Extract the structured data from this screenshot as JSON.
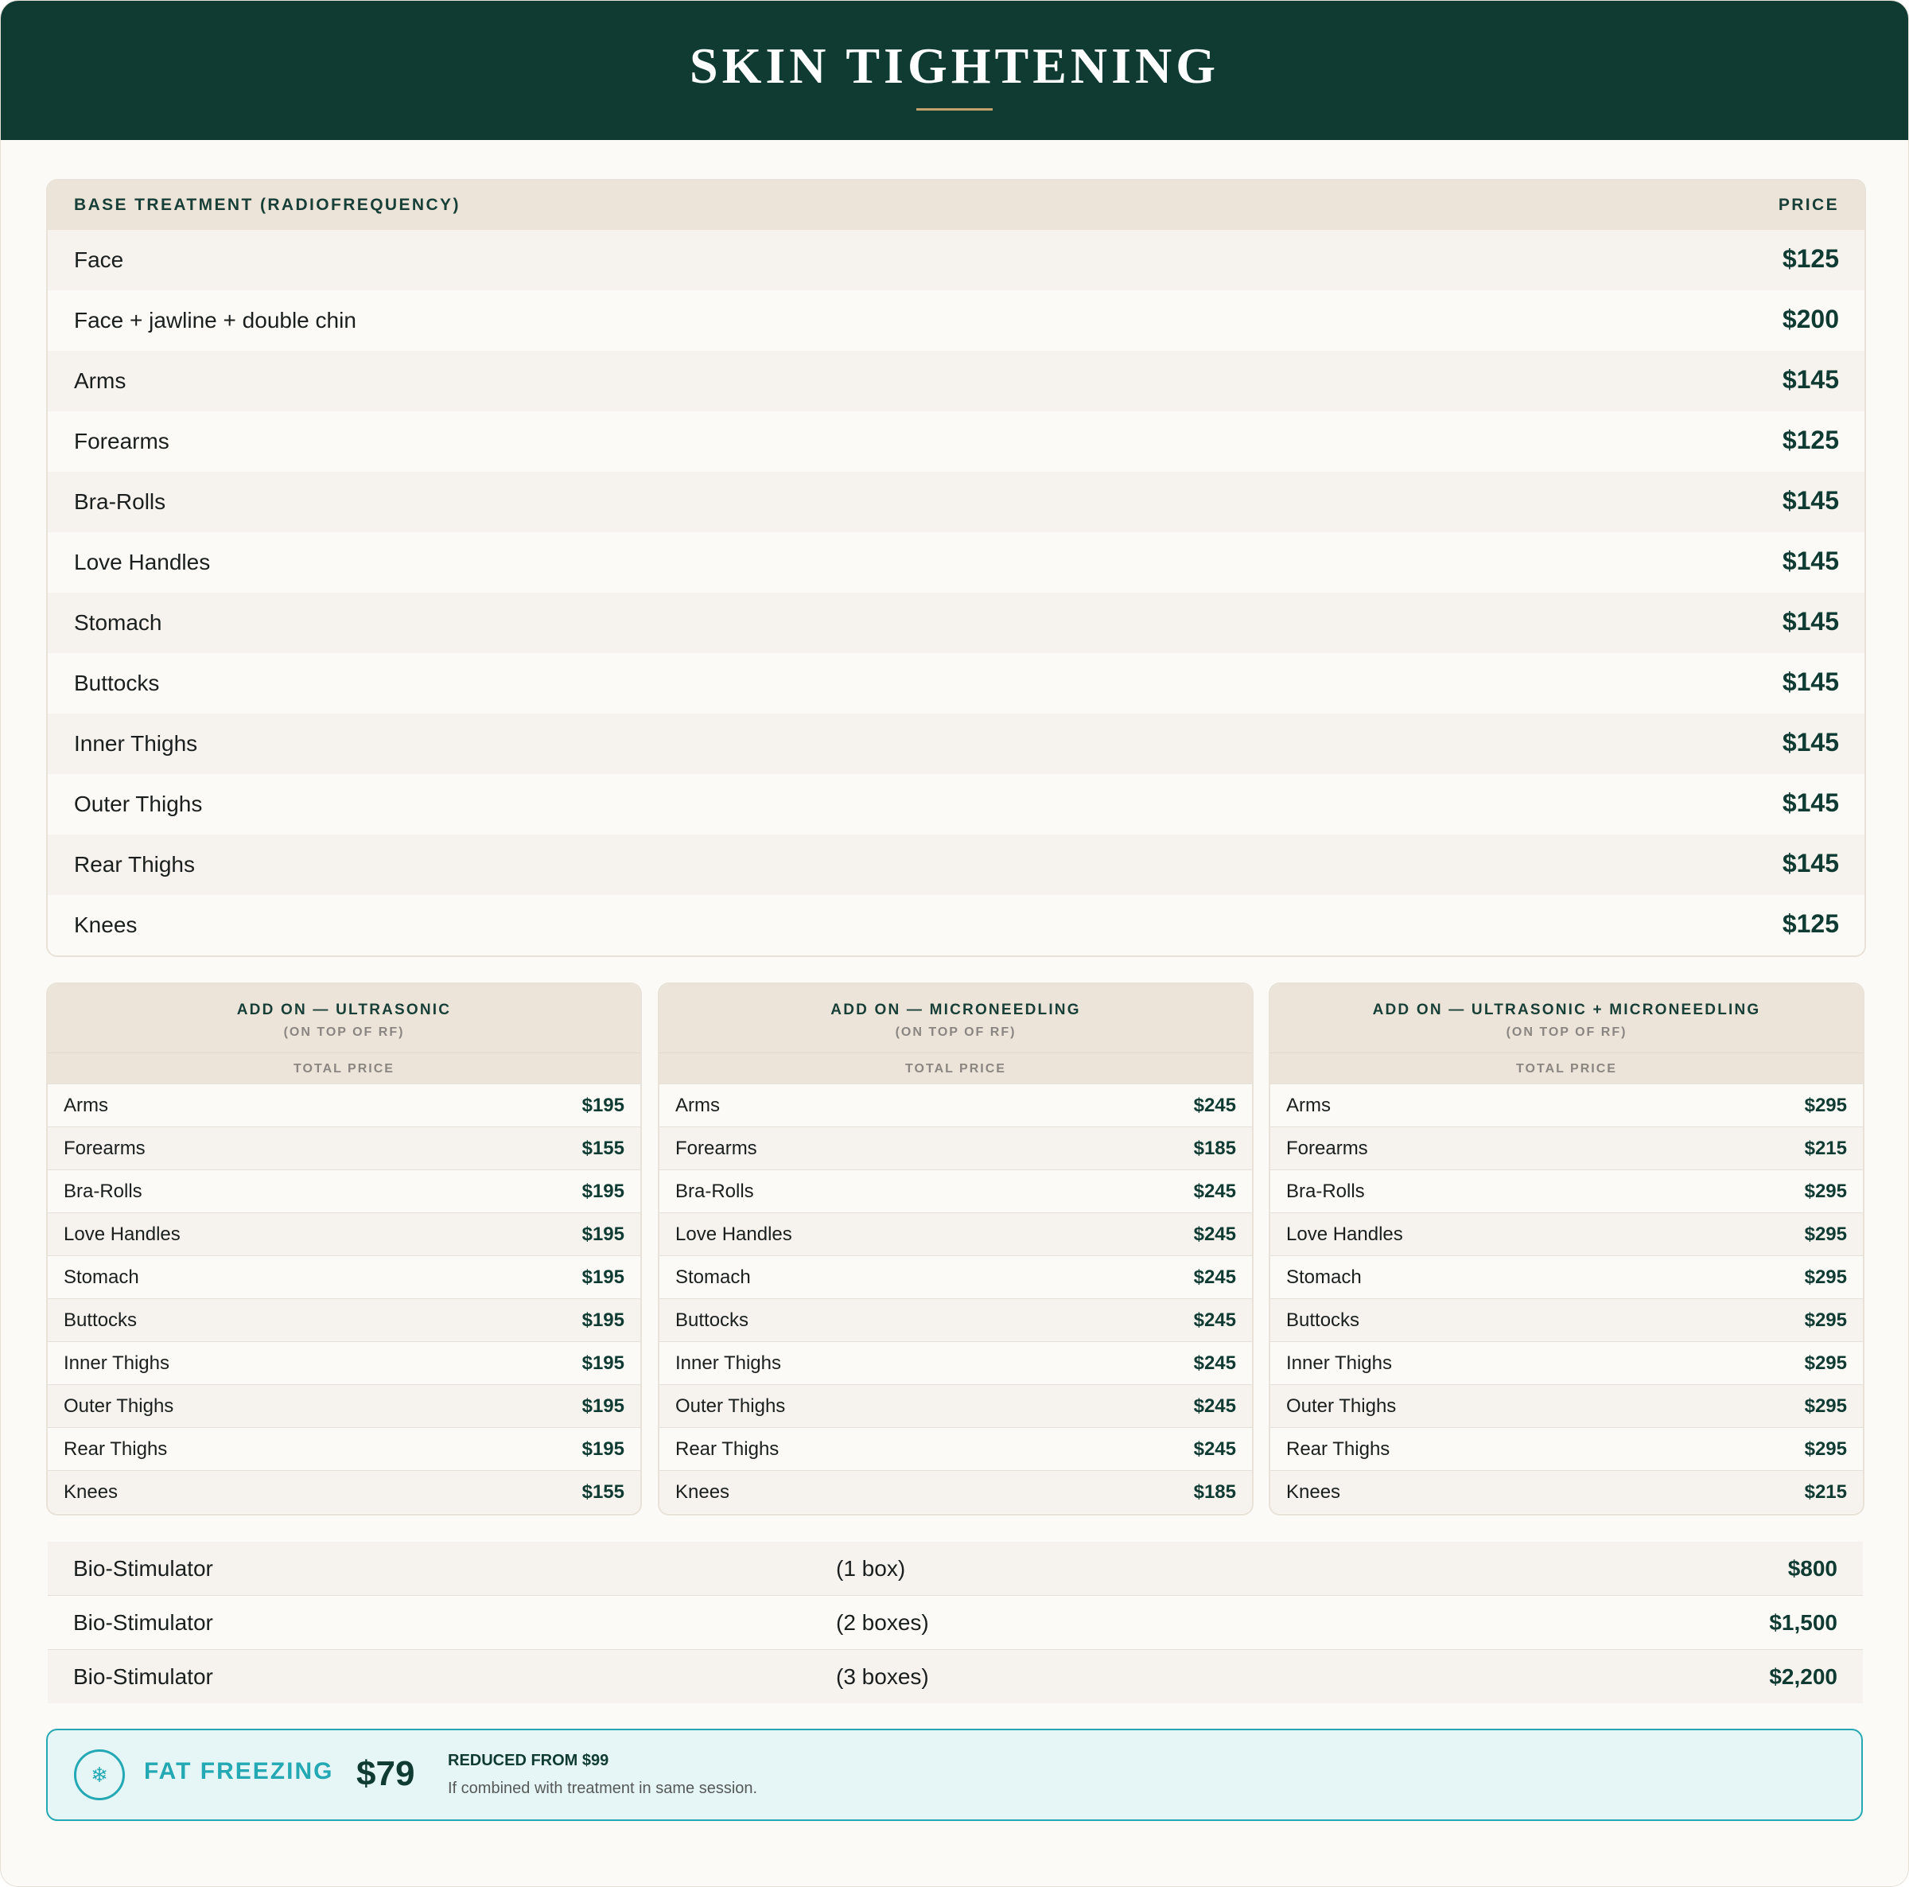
{
  "header": {
    "title": "SKIN TIGHTENING"
  },
  "base_table": {
    "col_treatment": "BASE TREATMENT (RADIOFREQUENCY)",
    "col_price": "PRICE",
    "rows": [
      {
        "name": "Face",
        "price": "$125"
      },
      {
        "name": "Face + jawline + double chin",
        "price": "$200"
      },
      {
        "name": "Arms",
        "price": "$145"
      },
      {
        "name": "Forearms",
        "price": "$125"
      },
      {
        "name": "Bra-Rolls",
        "price": "$145"
      },
      {
        "name": "Love Handles",
        "price": "$145"
      },
      {
        "name": "Stomach",
        "price": "$145"
      },
      {
        "name": "Buttocks",
        "price": "$145"
      },
      {
        "name": "Inner Thighs",
        "price": "$145"
      },
      {
        "name": "Outer Thighs",
        "price": "$145"
      },
      {
        "name": "Rear Thighs",
        "price": "$145"
      },
      {
        "name": "Knees",
        "price": "$125"
      }
    ]
  },
  "addons": [
    {
      "title": "ADD ON — ULTRASONIC",
      "subtitle": "(ON TOP OF RF)",
      "col_label": "TOTAL PRICE",
      "rows": [
        {
          "name": "Arms",
          "price": "$195"
        },
        {
          "name": "Forearms",
          "price": "$155"
        },
        {
          "name": "Bra-Rolls",
          "price": "$195"
        },
        {
          "name": "Love Handles",
          "price": "$195"
        },
        {
          "name": "Stomach",
          "price": "$195"
        },
        {
          "name": "Buttocks",
          "price": "$195"
        },
        {
          "name": "Inner Thighs",
          "price": "$195"
        },
        {
          "name": "Outer Thighs",
          "price": "$195"
        },
        {
          "name": "Rear Thighs",
          "price": "$195"
        },
        {
          "name": "Knees",
          "price": "$155"
        }
      ]
    },
    {
      "title": "ADD ON — MICRONEEDLING",
      "subtitle": "(ON TOP OF RF)",
      "col_label": "TOTAL PRICE",
      "rows": [
        {
          "name": "Arms",
          "price": "$245"
        },
        {
          "name": "Forearms",
          "price": "$185"
        },
        {
          "name": "Bra-Rolls",
          "price": "$245"
        },
        {
          "name": "Love Handles",
          "price": "$245"
        },
        {
          "name": "Stomach",
          "price": "$245"
        },
        {
          "name": "Buttocks",
          "price": "$245"
        },
        {
          "name": "Inner Thighs",
          "price": "$245"
        },
        {
          "name": "Outer Thighs",
          "price": "$245"
        },
        {
          "name": "Rear Thighs",
          "price": "$245"
        },
        {
          "name": "Knees",
          "price": "$185"
        }
      ]
    },
    {
      "title": "ADD ON — ULTRASONIC + MICRONEEDLING",
      "subtitle": "(ON TOP OF RF)",
      "col_label": "TOTAL PRICE",
      "rows": [
        {
          "name": "Arms",
          "price": "$295"
        },
        {
          "name": "Forearms",
          "price": "$215"
        },
        {
          "name": "Bra-Rolls",
          "price": "$295"
        },
        {
          "name": "Love Handles",
          "price": "$295"
        },
        {
          "name": "Stomach",
          "price": "$295"
        },
        {
          "name": "Buttocks",
          "price": "$295"
        },
        {
          "name": "Inner Thighs",
          "price": "$295"
        },
        {
          "name": "Outer Thighs",
          "price": "$295"
        },
        {
          "name": "Rear Thighs",
          "price": "$295"
        },
        {
          "name": "Knees",
          "price": "$215"
        }
      ]
    }
  ],
  "bio_stimulator": [
    {
      "name": "Bio-Stimulator",
      "qty": "(1 box)",
      "price": "$800"
    },
    {
      "name": "Bio-Stimulator",
      "qty": "(2 boxes)",
      "price": "$1,500"
    },
    {
      "name": "Bio-Stimulator",
      "qty": "(3 boxes)",
      "price": "$2,200"
    }
  ],
  "fat_freezing": {
    "icon": "snowflake-icon",
    "title": "FAT FREEZING",
    "price": "$79",
    "reduced": "REDUCED FROM $99",
    "note": "If combined with treatment in same session."
  },
  "colors": {
    "header_bg": "#0f3b33",
    "accent_gold": "#c4a06a",
    "accent_teal": "#24a9b4",
    "table_header_bg": "#ece4d9",
    "page_bg": "#fcfaf6"
  }
}
